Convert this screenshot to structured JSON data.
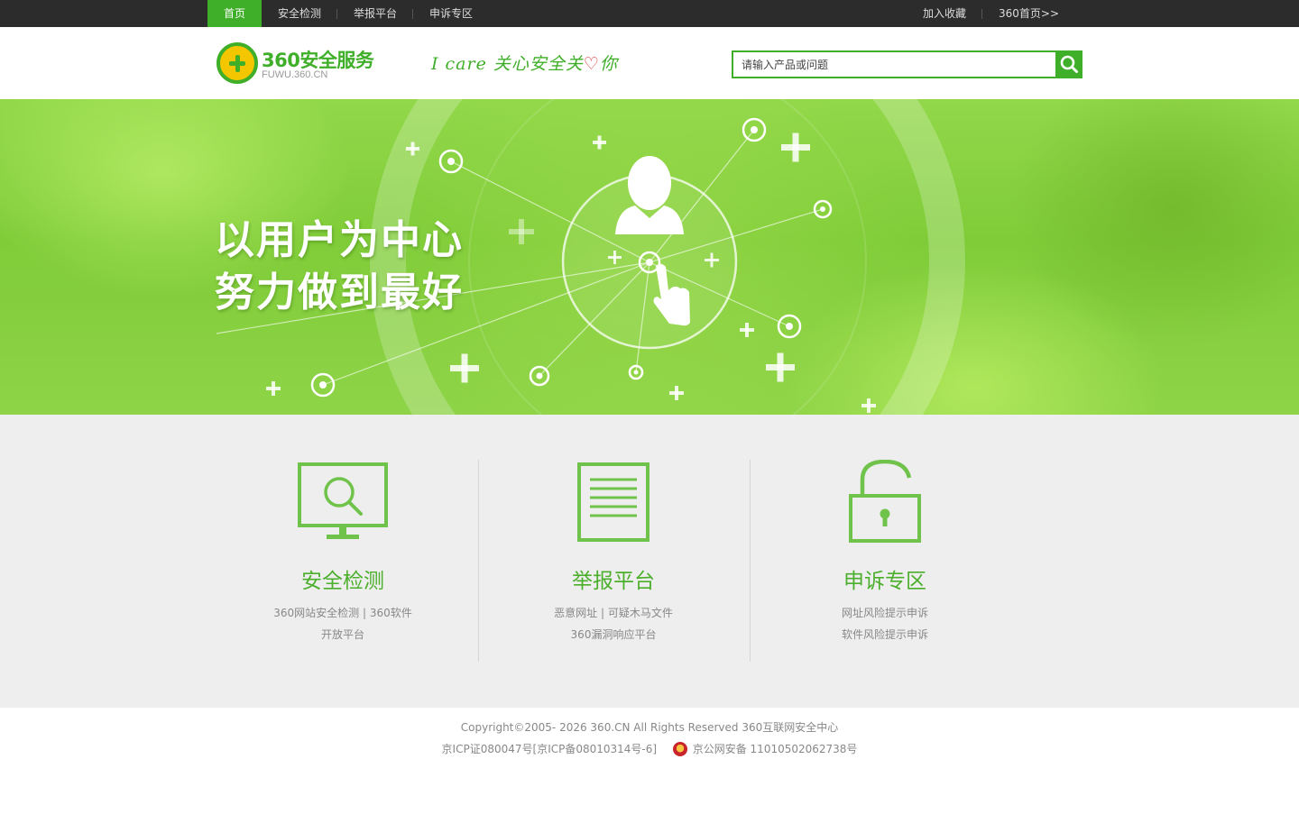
{
  "topnav": {
    "items": [
      {
        "label": "首页",
        "active": true
      },
      {
        "label": "安全检测"
      },
      {
        "label": "举报平台"
      },
      {
        "label": "申诉专区"
      }
    ],
    "right": [
      {
        "label": "加入收藏"
      },
      {
        "label": "360首页>>"
      }
    ]
  },
  "header": {
    "logo_title": "360安全服务",
    "logo_sub": "FUWU.360.CN",
    "slogan_pre": "I care 关心安全关",
    "slogan_heart": "♡",
    "slogan_post": "你",
    "search_placeholder": "请输入产品或问题"
  },
  "banner": {
    "line1": "以用户为中心",
    "line2": "努力做到最好"
  },
  "features": [
    {
      "title": "安全检测",
      "desc1": "360网站安全检测 | 360软件",
      "desc2": "开放平台",
      "icon": "monitor-search-icon"
    },
    {
      "title": "举报平台",
      "desc1": "恶意网址 | 可疑木马文件",
      "desc2": "360漏洞响应平台",
      "icon": "document-icon"
    },
    {
      "title": "申诉专区",
      "desc1": "网址风险提示申诉",
      "desc2": "软件风险提示申诉",
      "icon": "lock-icon"
    }
  ],
  "footer": {
    "copyright": "Copyright©2005- 2026 360.CN All Rights Reserved 360互联网安全中心",
    "icp": "京ICP证080047号[京ICP备08010314号-6]",
    "police": "京公网安备 11010502062738号"
  },
  "colors": {
    "brand_green": "#3fae29",
    "feature_green": "#4caf2c",
    "topbar": "#2c2c2c",
    "features_bg": "#eeeeee"
  }
}
